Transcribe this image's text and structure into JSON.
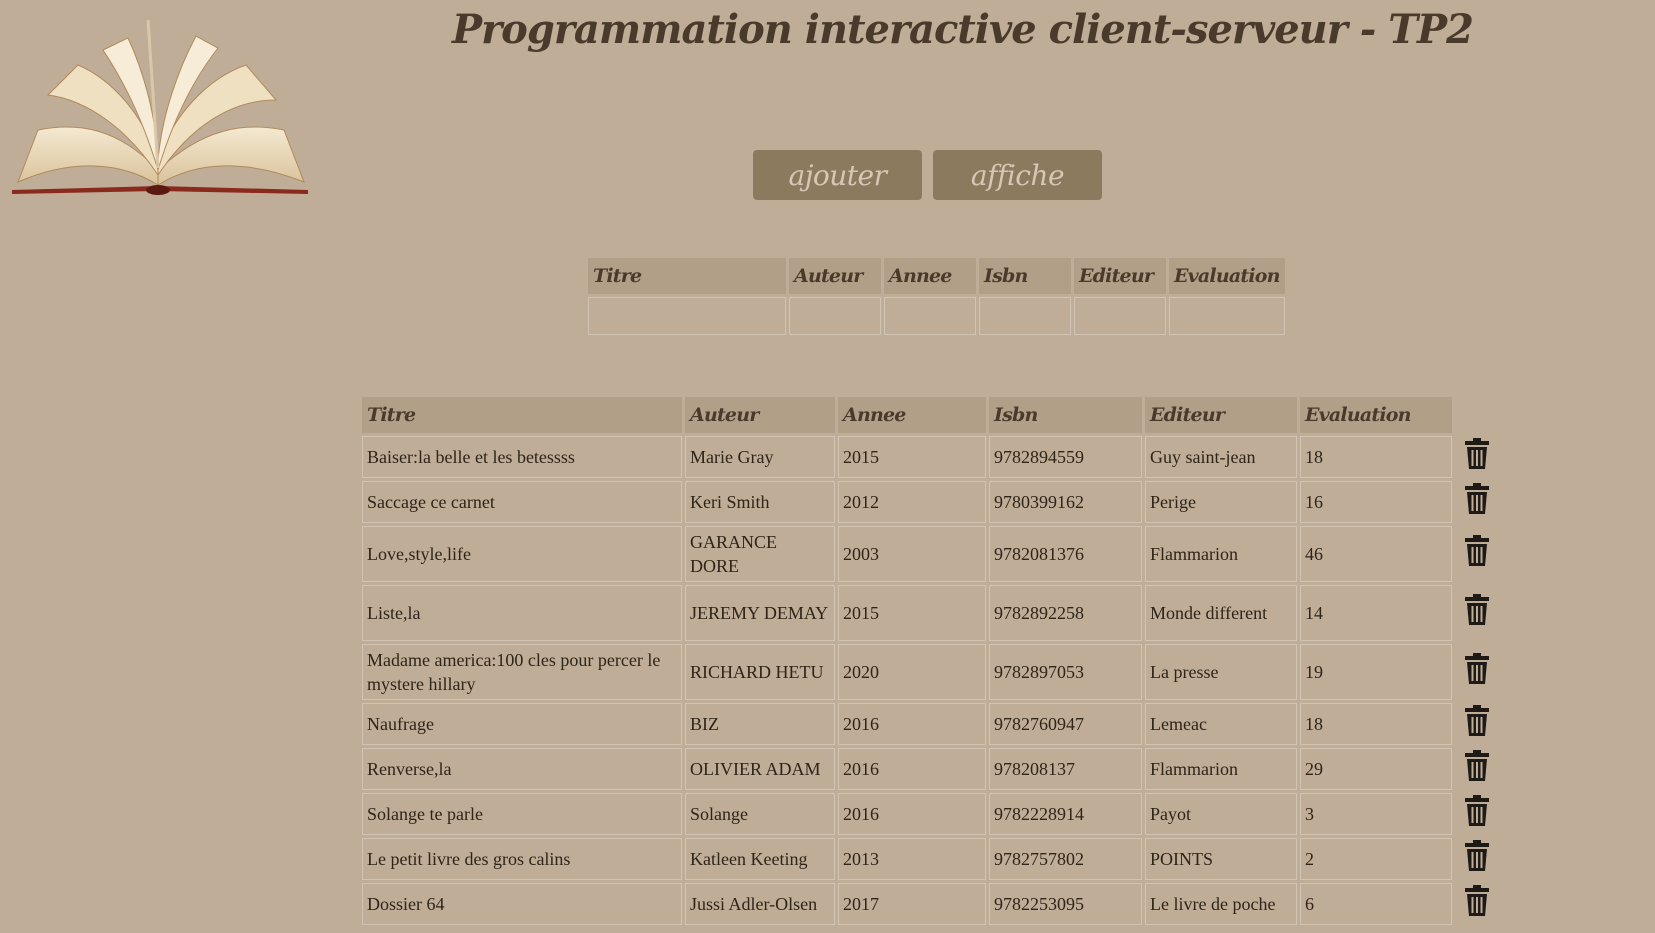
{
  "title": "Programmation interactive client-serveur - TP2",
  "buttons": {
    "ajouter": "ajouter",
    "affiche": "affiche"
  },
  "columns": [
    "Titre",
    "Auteur",
    "Annee",
    "Isbn",
    "Editeur",
    "Evaluation"
  ],
  "icons": {
    "logo": "open-book-logo",
    "delete": "trash-icon"
  },
  "books": [
    {
      "titre": "Baiser:la belle et les betessss",
      "auteur": "Marie Gray",
      "annee": "2015",
      "isbn": "9782894559",
      "editeur": "Guy saint-jean",
      "evaluation": "18"
    },
    {
      "titre": "Saccage ce carnet",
      "auteur": "Keri Smith",
      "annee": "2012",
      "isbn": "9780399162",
      "editeur": "Perige",
      "evaluation": "16"
    },
    {
      "titre": "Love,style,life",
      "auteur": "GARANCE DORE",
      "annee": "2003",
      "isbn": "9782081376",
      "editeur": "Flammarion",
      "evaluation": "46"
    },
    {
      "titre": "Liste,la",
      "auteur": "JEREMY DEMAY",
      "annee": "2015",
      "isbn": "9782892258",
      "editeur": "Monde different",
      "evaluation": "14"
    },
    {
      "titre": "Madame america:100 cles pour percer le mystere hillary",
      "auteur": "RICHARD HETU",
      "annee": "2020",
      "isbn": "9782897053",
      "editeur": "La presse",
      "evaluation": "19"
    },
    {
      "titre": "Naufrage",
      "auteur": "BIZ",
      "annee": "2016",
      "isbn": "9782760947",
      "editeur": "Lemeac",
      "evaluation": "18"
    },
    {
      "titre": "Renverse,la",
      "auteur": "OLIVIER ADAM",
      "annee": "2016",
      "isbn": "978208137",
      "editeur": "Flammarion",
      "evaluation": "29"
    },
    {
      "titre": "Solange te parle",
      "auteur": "Solange",
      "annee": "2016",
      "isbn": "9782228914",
      "editeur": "Payot",
      "evaluation": "3"
    },
    {
      "titre": "Le petit livre des gros calins",
      "auteur": "Katleen Keeting",
      "annee": "2013",
      "isbn": "9782757802",
      "editeur": "POINTS",
      "evaluation": "2"
    },
    {
      "titre": "Dossier 64",
      "auteur": "Jussi Adler-Olsen",
      "annee": "2017",
      "isbn": "9782253095",
      "editeur": "Le livre de poche",
      "evaluation": "6"
    }
  ]
}
